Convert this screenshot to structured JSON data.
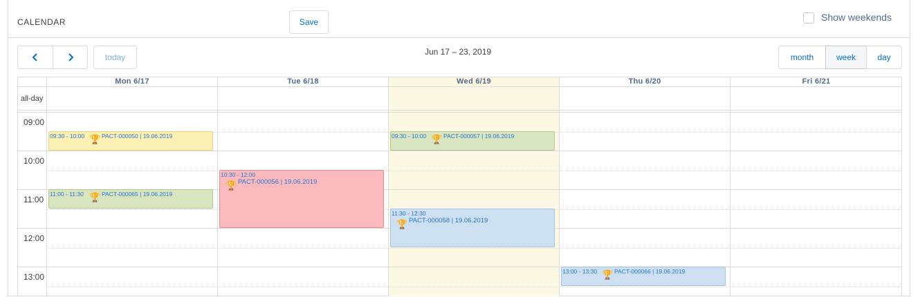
{
  "header": {
    "title": "CALENDAR",
    "save_label": "Save",
    "weekends_label": "Show weekends",
    "weekends_checked": false
  },
  "toolbar": {
    "prev_icon": "chevron-left-icon",
    "next_icon": "chevron-right-icon",
    "today_label": "today",
    "date_range": "Jun 17 – 23, 2019",
    "views": [
      "month",
      "week",
      "day"
    ],
    "active_view": "week"
  },
  "grid": {
    "days": [
      "Mon 6/17",
      "Tue 6/18",
      "Wed 6/19",
      "Thu 6/20",
      "Fri 6/21"
    ],
    "today_day": "Wed 6/19",
    "allday_label": "all-day",
    "times": [
      "09:00",
      "10:00",
      "11:00",
      "12:00",
      "13:00"
    ]
  },
  "events": [
    {
      "time": "09:30 - 10:00",
      "label": "PACT-000050 | 19.06.2019",
      "icon": "trophy-icon",
      "color": "#fbf0b4",
      "day": "Mon 6/17"
    },
    {
      "time": "11:00 - 11:30",
      "label": "PACT-000065 | 19.06.2019",
      "icon": "trophy-icon",
      "color": "#d9e5c1",
      "day": "Mon 6/17"
    },
    {
      "time": "10:30 - 12:00",
      "label": "PACT-000056 | 19.06.2019",
      "icon": "trophy-icon",
      "color": "#fbbbbe",
      "day": "Tue 6/18"
    },
    {
      "time": "09:30 - 10:00",
      "label": "PACT-000057 | 19.06.2019",
      "icon": "trophy-icon",
      "color": "#d9e5c1",
      "day": "Wed 6/19"
    },
    {
      "time": "11:30 - 12:30",
      "label": "PACT-000058 | 19.06.2019",
      "icon": "trophy-icon",
      "color": "#cce0f2",
      "day": "Wed 6/19"
    },
    {
      "time": "13:00 - 13:30",
      "label": "PACT-000066 | 19.06.2019",
      "icon": "trophy-icon",
      "color": "#cce0f2",
      "day": "Thu 6/20"
    }
  ]
}
